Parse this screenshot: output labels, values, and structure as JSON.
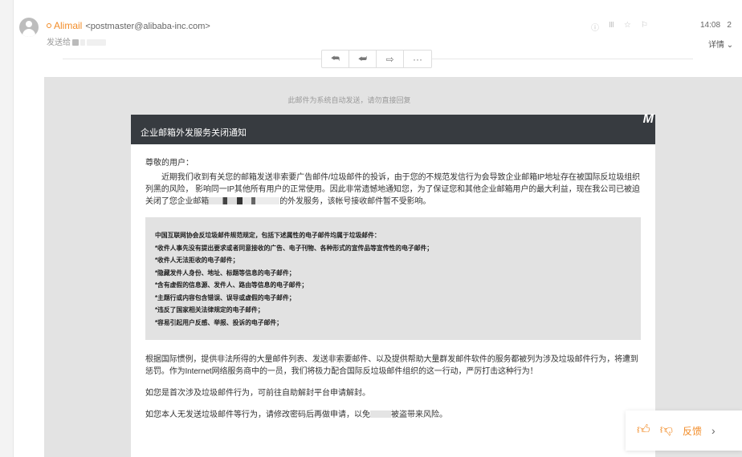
{
  "header": {
    "sender_name": "Alimail",
    "sender_email": "<postmaster@alibaba-inc.com>",
    "to_label": "发送给",
    "time": "14:08",
    "time_suffix": "2",
    "detail_label": "详情",
    "icons": [
      "info-icon",
      "menu-icon",
      "star-icon",
      "flag-icon"
    ]
  },
  "toolbar": {
    "buttons": [
      "reply-icon",
      "reply-all-icon",
      "forward-icon",
      "more-icon"
    ],
    "more_label": "···"
  },
  "mail": {
    "auto_note": "此邮件为系统自动发送，请勿直接回复",
    "notice_title": "企业邮箱外发服务关闭通知",
    "logo": "M",
    "greeting": "尊敬的用户：",
    "para1_a": "近期我们收到有关您的邮箱发送非索要广告邮件/垃圾邮件的投诉，由于您的不规范发信行为会导致企业邮箱IP地址存在被国际反垃圾组织列黑的风险， 影响同一IP其他所有用户的正常使用。因此非常遗憾地通知您，为了保证您和其他企业邮箱用户的最大利益，现在我公司已被迫关闭了您企业邮箱",
    "para1_b": "的外发服务，该帐号接收邮件暂不受影响。",
    "rules": [
      "中国互联网协会反垃圾邮件规范规定，包括下述属性的电子邮件均属于垃圾邮件：",
      "*收件人事先没有提出要求或者同意接收的广告、电子刊物、各种形式的宣传品等宣传性的电子邮件；",
      "*收件人无法拒收的电子邮件；",
      "*隐藏发件人身份、地址、标题等信息的电子邮件；",
      "*含有虚假的信息源、发件人、路由等信息的电子邮件；",
      "*主题行或内容包含错误、误导或虚假的电子邮件；",
      "*违反了国家相关法律规定的电子邮件；",
      "*容易引起用户反感、举报、投诉的电子邮件；"
    ],
    "para2": "根据国际惯例，提供非法所得的大量邮件列表、发送非索要邮件、以及提供帮助大量群发邮件软件的服务都被列为涉及垃圾邮件行为，将遭到惩罚。作为Internet网络服务商中的一员，我们将极力配合国际反垃圾邮件组织的这一行动，严厉打击这种行为！",
    "para3": "如您是首次涉及垃圾邮件行为，可前往自助解封平台申请解封。",
    "para4_a": "如您本人无发送垃圾邮件等行为，请修改密码后再做申请，以免",
    "para4_b": "被盗带来风险。"
  },
  "feedback": {
    "label": "反馈",
    "close": "›"
  }
}
